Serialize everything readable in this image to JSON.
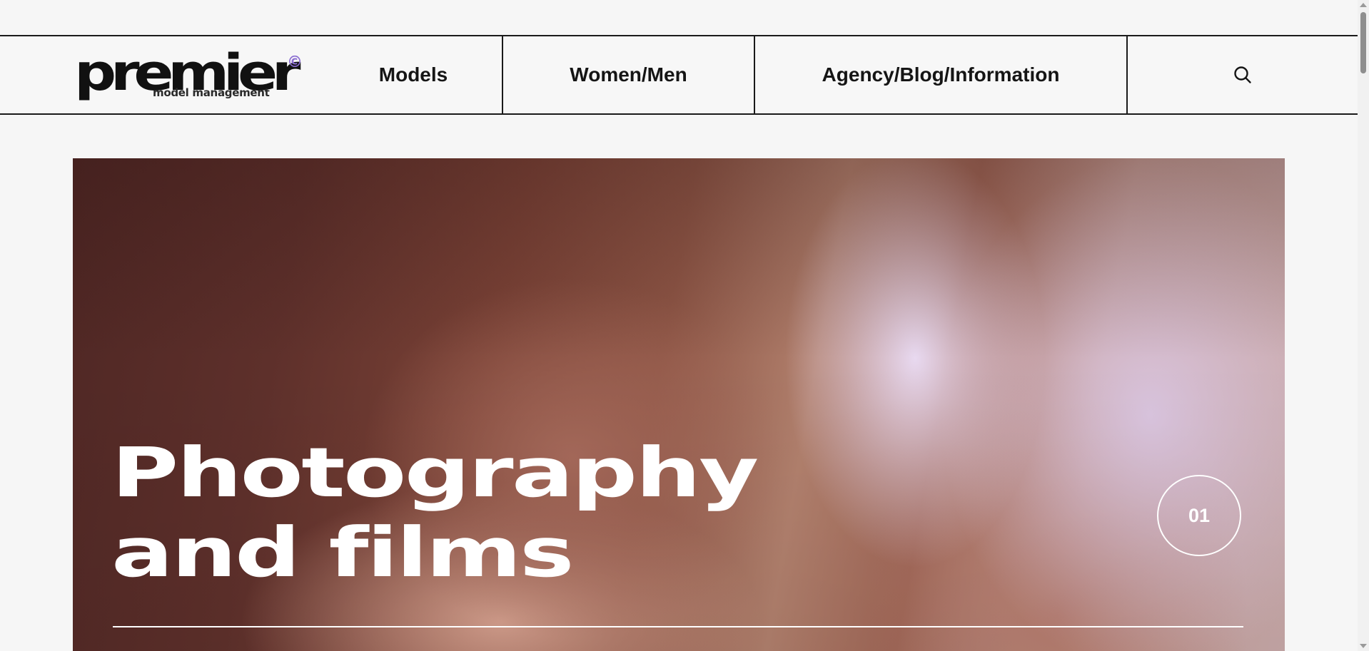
{
  "header": {
    "logo": {
      "word": "premier",
      "sub": "model management",
      "mark": "©"
    },
    "nav": [
      {
        "label": "Models"
      },
      {
        "label": "Women/Men"
      },
      {
        "label": "Agency/Blog/Information"
      }
    ],
    "search_icon": "search-icon"
  },
  "hero": {
    "title_line1": "Photography",
    "title_line2": "and films",
    "counter": "01"
  },
  "colors": {
    "background": "#f6f6f6",
    "text": "#151515",
    "logo_accent": "#8a6cd1",
    "hero_text": "#ffffff"
  }
}
